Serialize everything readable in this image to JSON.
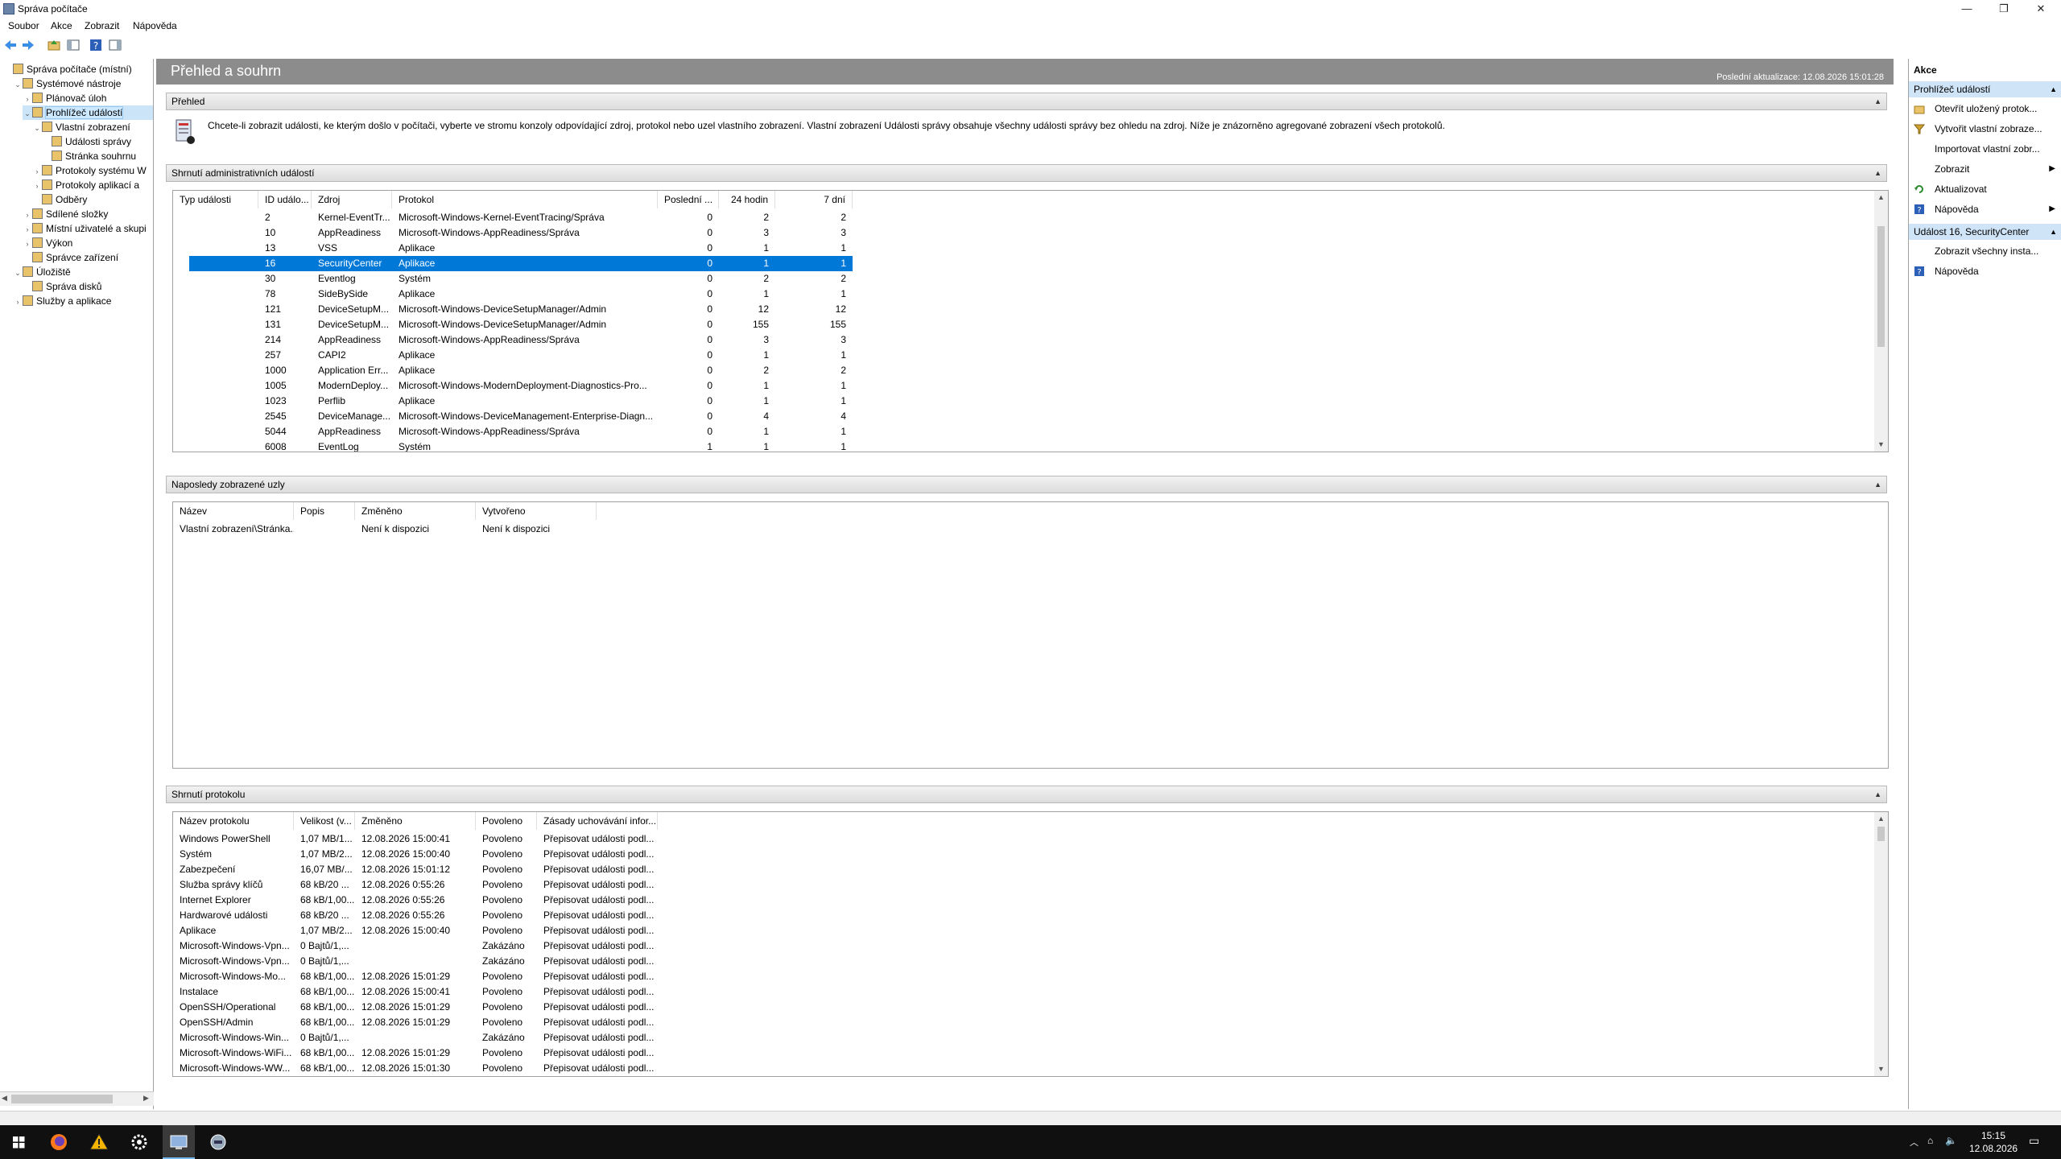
{
  "window": {
    "title": "Správa počítače"
  },
  "menu": [
    "Soubor",
    "Akce",
    "Zobrazit",
    "Nápověda"
  ],
  "tree": [
    {
      "label": "Správa počítače (místní)",
      "level": 0,
      "exp": ""
    },
    {
      "label": "Systémové nástroje",
      "level": 1,
      "exp": "⌄"
    },
    {
      "label": "Plánovač úloh",
      "level": 2,
      "exp": "›"
    },
    {
      "label": "Prohlížeč událostí",
      "level": 2,
      "exp": "⌄",
      "selected": true
    },
    {
      "label": "Vlastní zobrazení",
      "level": 3,
      "exp": "⌄"
    },
    {
      "label": "Události správy",
      "level": 4,
      "exp": ""
    },
    {
      "label": "Stránka souhrnu",
      "level": 4,
      "exp": ""
    },
    {
      "label": "Protokoly systému W",
      "level": 3,
      "exp": "›"
    },
    {
      "label": "Protokoly aplikací a",
      "level": 3,
      "exp": "›"
    },
    {
      "label": "Odběry",
      "level": 3,
      "exp": ""
    },
    {
      "label": "Sdílené složky",
      "level": 2,
      "exp": "›"
    },
    {
      "label": "Místní uživatelé a skupi",
      "level": 2,
      "exp": "›"
    },
    {
      "label": "Výkon",
      "level": 2,
      "exp": "›"
    },
    {
      "label": "Správce zařízení",
      "level": 2,
      "exp": ""
    },
    {
      "label": "Úložiště",
      "level": 1,
      "exp": "⌄"
    },
    {
      "label": "Správa disků",
      "level": 2,
      "exp": ""
    },
    {
      "label": "Služby a aplikace",
      "level": 1,
      "exp": "›"
    }
  ],
  "main": {
    "title": "Přehled a souhrn",
    "last_update": "Poslední aktualizace: 12.08.2026 15:01:28",
    "overview_title": "Přehled",
    "overview_text": "Chcete-li zobrazit události, ke kterým došlo v počítači, vyberte ve stromu konzoly odpovídající zdroj, protokol nebo uzel vlastního zobrazení. Vlastní zobrazení Události správy obsahuje všechny události správy bez ohledu na zdroj. Níže je znázorněno agregované zobrazení všech protokolů.",
    "admin_title": "Shrnutí administrativních událostí",
    "admin_headers": [
      "Typ události",
      "ID událo...",
      "Zdroj",
      "Protokol",
      "Poslední ...",
      "24 hodin",
      "7 dní"
    ],
    "admin_rows": [
      [
        "",
        "2",
        "Kernel-EventTr...",
        "Microsoft-Windows-Kernel-EventTracing/Správa",
        "0",
        "2",
        "2"
      ],
      [
        "",
        "10",
        "AppReadiness",
        "Microsoft-Windows-AppReadiness/Správa",
        "0",
        "3",
        "3"
      ],
      [
        "",
        "13",
        "VSS",
        "Aplikace",
        "0",
        "1",
        "1"
      ],
      [
        "",
        "16",
        "SecurityCenter",
        "Aplikace",
        "0",
        "1",
        "1"
      ],
      [
        "",
        "30",
        "Eventlog",
        "Systém",
        "0",
        "2",
        "2"
      ],
      [
        "",
        "78",
        "SideBySide",
        "Aplikace",
        "0",
        "1",
        "1"
      ],
      [
        "",
        "121",
        "DeviceSetupM...",
        "Microsoft-Windows-DeviceSetupManager/Admin",
        "0",
        "12",
        "12"
      ],
      [
        "",
        "131",
        "DeviceSetupM...",
        "Microsoft-Windows-DeviceSetupManager/Admin",
        "0",
        "155",
        "155"
      ],
      [
        "",
        "214",
        "AppReadiness",
        "Microsoft-Windows-AppReadiness/Správa",
        "0",
        "3",
        "3"
      ],
      [
        "",
        "257",
        "CAPI2",
        "Aplikace",
        "0",
        "1",
        "1"
      ],
      [
        "",
        "1000",
        "Application Err...",
        "Aplikace",
        "0",
        "2",
        "2"
      ],
      [
        "",
        "1005",
        "ModernDeploy...",
        "Microsoft-Windows-ModernDeployment-Diagnostics-Pro...",
        "0",
        "1",
        "1"
      ],
      [
        "",
        "1023",
        "Perflib",
        "Aplikace",
        "0",
        "1",
        "1"
      ],
      [
        "",
        "2545",
        "DeviceManage...",
        "Microsoft-Windows-DeviceManagement-Enterprise-Diagn...",
        "0",
        "4",
        "4"
      ],
      [
        "",
        "5044",
        "AppReadiness",
        "Microsoft-Windows-AppReadiness/Správa",
        "0",
        "1",
        "1"
      ],
      [
        "",
        "6008",
        "EventLog",
        "Systém",
        "1",
        "1",
        "1"
      ]
    ],
    "admin_selected_row": 3,
    "recent_title": "Naposledy zobrazené uzly",
    "recent_headers": [
      "Název",
      "Popis",
      "Změněno",
      "Vytvořeno"
    ],
    "recent_rows": [
      [
        "Vlastní zobrazení\\Stránka...",
        "",
        "Není k dispozici",
        "Není k dispozici"
      ]
    ],
    "log_title": "Shrnutí protokolu",
    "log_headers": [
      "Název protokolu",
      "Velikost (v...",
      "Změněno",
      "Povoleno",
      "Zásady uchovávání infor..."
    ],
    "log_rows": [
      [
        "Windows PowerShell",
        "1,07 MB/1...",
        "12.08.2026 15:00:41",
        "Povoleno",
        "Přepisovat události podl..."
      ],
      [
        "Systém",
        "1,07 MB/2...",
        "12.08.2026 15:00:40",
        "Povoleno",
        "Přepisovat události podl..."
      ],
      [
        "Zabezpečení",
        "16,07 MB/...",
        "12.08.2026 15:01:12",
        "Povoleno",
        "Přepisovat události podl..."
      ],
      [
        "Služba správy klíčů",
        "68 kB/20 ...",
        "12.08.2026 0:55:26",
        "Povoleno",
        "Přepisovat události podl..."
      ],
      [
        "Internet Explorer",
        "68 kB/1,00...",
        "12.08.2026 0:55:26",
        "Povoleno",
        "Přepisovat události podl..."
      ],
      [
        "Hardwarové události",
        "68 kB/20 ...",
        "12.08.2026 0:55:26",
        "Povoleno",
        "Přepisovat události podl..."
      ],
      [
        "Aplikace",
        "1,07 MB/2...",
        "12.08.2026 15:00:40",
        "Povoleno",
        "Přepisovat události podl..."
      ],
      [
        "Microsoft-Windows-Vpn...",
        "0 Bajtů/1,...",
        "",
        "Zakázáno",
        "Přepisovat události podl..."
      ],
      [
        "Microsoft-Windows-Vpn...",
        "0 Bajtů/1,...",
        "",
        "Zakázáno",
        "Přepisovat události podl..."
      ],
      [
        "Microsoft-Windows-Mo...",
        "68 kB/1,00...",
        "12.08.2026 15:01:29",
        "Povoleno",
        "Přepisovat události podl..."
      ],
      [
        "Instalace",
        "68 kB/1,00...",
        "12.08.2026 15:00:41",
        "Povoleno",
        "Přepisovat události podl..."
      ],
      [
        "OpenSSH/Operational",
        "68 kB/1,00...",
        "12.08.2026 15:01:29",
        "Povoleno",
        "Přepisovat události podl..."
      ],
      [
        "OpenSSH/Admin",
        "68 kB/1,00...",
        "12.08.2026 15:01:29",
        "Povoleno",
        "Přepisovat události podl..."
      ],
      [
        "Microsoft-Windows-Win...",
        "0 Bajtů/1,...",
        "",
        "Zakázáno",
        "Přepisovat události podl..."
      ],
      [
        "Microsoft-Windows-WiFi...",
        "68 kB/1,00...",
        "12.08.2026 15:01:29",
        "Povoleno",
        "Přepisovat události podl..."
      ],
      [
        "Microsoft-Windows-WW...",
        "68 kB/1,00...",
        "12.08.2026 15:01:30",
        "Povoleno",
        "Přepisovat události podl..."
      ]
    ]
  },
  "actions": {
    "title": "Akce",
    "group1": "Prohlížeč událostí",
    "items1": [
      {
        "label": "Otevřít uložený protok...",
        "icon": "folder-icon",
        "sub": ""
      },
      {
        "label": "Vytvořit vlastní zobraze...",
        "icon": "filter-icon",
        "sub": ""
      },
      {
        "label": "Importovat vlastní zobr...",
        "icon": "",
        "sub": ""
      },
      {
        "label": "Zobrazit",
        "icon": "",
        "sub": "▶"
      },
      {
        "label": "Aktualizovat",
        "icon": "refresh-icon",
        "sub": ""
      },
      {
        "label": "Nápověda",
        "icon": "help-icon",
        "sub": "▶"
      }
    ],
    "group2": "Událost 16, SecurityCenter",
    "items2": [
      {
        "label": "Zobrazit všechny insta...",
        "icon": "",
        "sub": ""
      },
      {
        "label": "Nápověda",
        "icon": "help-icon",
        "sub": ""
      }
    ]
  },
  "taskbar": {
    "time": "15:15",
    "date": "12.08.2026"
  }
}
